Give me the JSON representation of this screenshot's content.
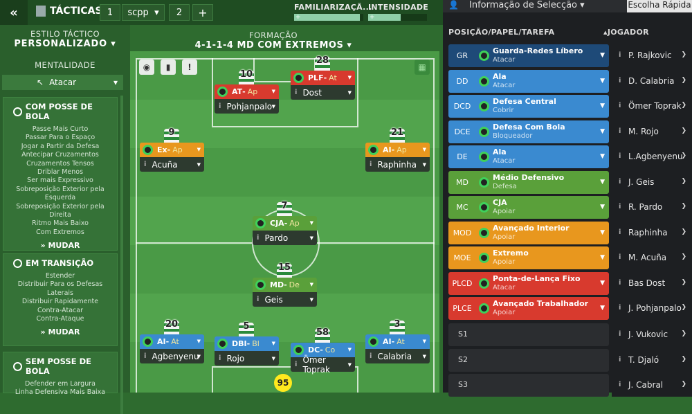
{
  "topbar": {
    "back": "«",
    "tacticas": "TÁCTICAS",
    "slot": "1",
    "team": "scpp",
    "slot2": "2",
    "add": "+",
    "fam_label": "FAMILIARIZAÇÃ...",
    "int_label": "INTENSIDADE",
    "fam_value": 0.95,
    "int_value": 0.55
  },
  "left": {
    "estilo_label": "ESTILO TÁCTICO",
    "estilo_value": "PERSONALIZADO",
    "ment_label": "MENTALIDADE",
    "ment_value": "Atacar",
    "panels": [
      {
        "title": "COM POSSE DE BOLA",
        "items": [
          "Passe Mais Curto",
          "Passar Para o Espaço",
          "Jogar a Partir da Defesa",
          "Antecipar Cruzamentos",
          "Cruzamentos Tensos",
          "Driblar Menos",
          "Ser mais Expressivo",
          "Sobreposição Exterior pela",
          "Esquerda",
          "Sobreposição Exterior pela",
          "Direita",
          "Ritmo Mais Baixo",
          "Com Extremos"
        ],
        "action": "MUDAR"
      },
      {
        "title": "EM TRANSIÇÃO",
        "items": [
          "Estender",
          "Distribuir Para os Defesas",
          "Laterais",
          "Distribuir Rapidamente",
          "Contra-Atacar",
          "Contra-Ataque"
        ],
        "action": "MUDAR"
      },
      {
        "title": "SEM POSSE DE BOLA",
        "items": [
          "Defender em Largura",
          "Linha Defensiva Mais Baixa"
        ]
      }
    ]
  },
  "formation": {
    "label": "FORMAÇÃO",
    "value": "4-1-1-4 MD COM EXTREMOS"
  },
  "pitch": {
    "players": [
      {
        "num": "10",
        "role": "AT",
        "sub": "Ap",
        "name": "Pohjanpalo",
        "color": "#d83a2e"
      },
      {
        "num": "28",
        "role": "PLF",
        "sub": "At",
        "name": "Dost",
        "color": "#d83a2e"
      },
      {
        "num": "9",
        "role": "Ex",
        "sub": "Ap",
        "name": "Acuña",
        "color": "#e8971e"
      },
      {
        "num": "21",
        "role": "AI",
        "sub": "Ap",
        "name": "Raphinha",
        "color": "#e8971e"
      },
      {
        "num": "7",
        "role": "CJA",
        "sub": "Ap",
        "name": "Pardo",
        "color": "#5aa03a"
      },
      {
        "num": "15",
        "role": "MD",
        "sub": "De",
        "name": "Geis",
        "color": "#5aa03a"
      },
      {
        "num": "20",
        "role": "AI",
        "sub": "At",
        "name": "Agbenyenu",
        "color": "#3a8ad0"
      },
      {
        "num": "5",
        "role": "DBI",
        "sub": "Bl",
        "name": "Rojo",
        "color": "#3a8ad0"
      },
      {
        "num": "58",
        "role": "DC",
        "sub": "Co",
        "name": "Ömer Toprak",
        "color": "#3a8ad0"
      },
      {
        "num": "3",
        "role": "AI",
        "sub": "At",
        "name": "Calabria",
        "color": "#3a8ad0"
      }
    ],
    "gk_num": "95"
  },
  "right": {
    "title": "Informação de Selecção",
    "quick": "Escolha Rápida",
    "col_pos": "POSIÇÃO/PAPEL/TAREFA",
    "col_player": "JOGADOR",
    "rows": [
      {
        "code": "GR",
        "role": "Guarda-Redes Líbero",
        "duty": "Atacar",
        "player": "P. Rajkovic",
        "color": "#1e4a78"
      },
      {
        "code": "DD",
        "role": "Ala",
        "duty": "Atacar",
        "player": "D. Calabria",
        "color": "#3a8ad0"
      },
      {
        "code": "DCD",
        "role": "Defesa Central",
        "duty": "Cobrir",
        "player": "Ömer Toprak",
        "color": "#3a8ad0"
      },
      {
        "code": "DCE",
        "role": "Defesa Com Bola",
        "duty": "Bloqueador",
        "player": "M. Rojo",
        "color": "#3a8ad0"
      },
      {
        "code": "DE",
        "role": "Ala",
        "duty": "Atacar",
        "player": "L.Agbenyenu",
        "color": "#3a8ad0"
      },
      {
        "code": "MD",
        "role": "Médio Defensivo",
        "duty": "Defesa",
        "player": "J. Geis",
        "color": "#5aa03a"
      },
      {
        "code": "MC",
        "role": "CJA",
        "duty": "Apoiar",
        "player": "R. Pardo",
        "color": "#5aa03a"
      },
      {
        "code": "MOD",
        "role": "Avançado Interior",
        "duty": "Apoiar",
        "player": "Raphinha",
        "color": "#e8971e"
      },
      {
        "code": "MOE",
        "role": "Extremo",
        "duty": "Apoiar",
        "player": "M. Acuña",
        "color": "#e8971e"
      },
      {
        "code": "PLCD",
        "role": "Ponta-de-Lança Fixo",
        "duty": "Atacar",
        "player": "Bas Dost",
        "color": "#d83a2e"
      },
      {
        "code": "PLCE",
        "role": "Avançado Trabalhador",
        "duty": "Apoiar",
        "player": "J. Pohjanpalo",
        "color": "#d83a2e"
      }
    ],
    "subs": [
      {
        "code": "S1",
        "player": "J. Vukovic"
      },
      {
        "code": "S2",
        "player": "T. Djaló"
      },
      {
        "code": "S3",
        "player": "J. Cabral"
      }
    ]
  }
}
